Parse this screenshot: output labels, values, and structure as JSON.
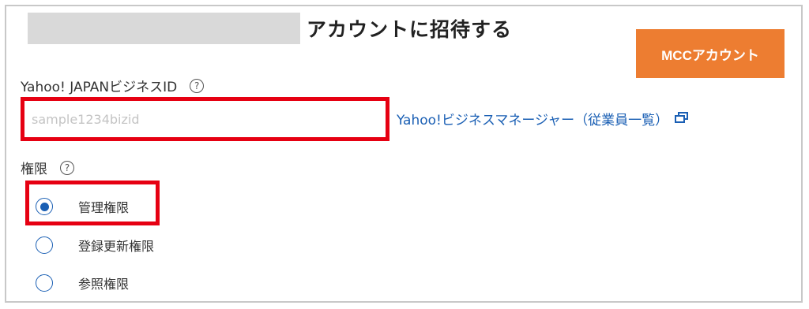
{
  "header": {
    "title": "アカウントに招待する",
    "mcc_button_label": "MCCアカウント"
  },
  "id_field": {
    "label": "Yahoo! JAPANビジネスID",
    "help": "?",
    "placeholder": "sample1234bizid",
    "value": ""
  },
  "business_manager_link": {
    "label": "Yahoo!ビジネスマネージャー（従業員一覧）",
    "icon": "external-window-icon"
  },
  "permission": {
    "label": "権限",
    "help": "?",
    "options": [
      {
        "label": "管理権限",
        "selected": true
      },
      {
        "label": "登録更新権限",
        "selected": false
      },
      {
        "label": "参照権限",
        "selected": false
      }
    ]
  },
  "colors": {
    "accent_orange": "#ed7d31",
    "link_blue": "#1a5fb4",
    "highlight_red": "#e60012",
    "redaction_gray": "#d9d9d9"
  }
}
